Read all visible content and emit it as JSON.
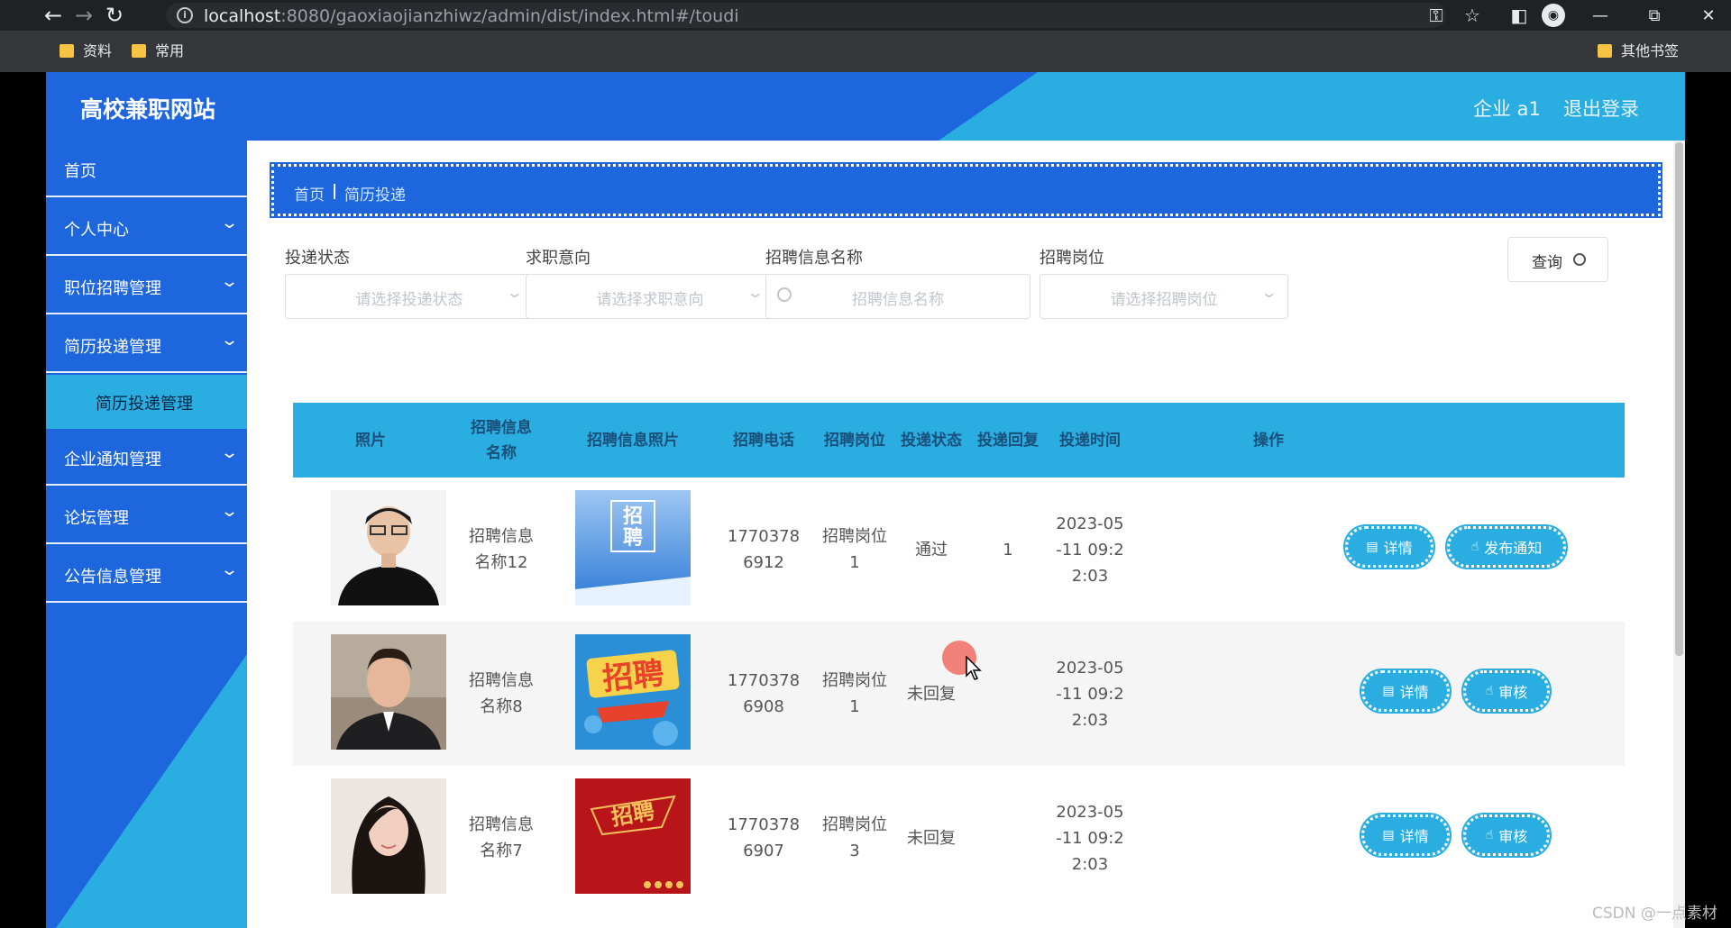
{
  "browser": {
    "url_host": "localhost",
    "url_rest": ":8080/gaoxiaojianzhiwz/admin/dist/index.html#/toudi",
    "bookmarks": [
      "资料",
      "常用"
    ],
    "other_bookmarks": "其他书签"
  },
  "header": {
    "brand": "高校兼职网站",
    "user": "企业 a1",
    "logout": "退出登录"
  },
  "sidebar": {
    "items": [
      {
        "label": "首页"
      },
      {
        "label": "个人中心"
      },
      {
        "label": "职位招聘管理"
      },
      {
        "label": "简历投递管理"
      },
      {
        "label": "企业通知管理"
      },
      {
        "label": "论坛管理"
      },
      {
        "label": "公告信息管理"
      }
    ],
    "sub_active": "简历投递管理"
  },
  "breadcrumb": {
    "home": "首页",
    "sep": "|",
    "current": "简历投递"
  },
  "filters": {
    "status_label": "投递状态",
    "status_placeholder": "请选择投递状态",
    "intent_label": "求职意向",
    "intent_placeholder": "请选择求职意向",
    "name_label": "招聘信息名称",
    "name_placeholder": "招聘信息名称",
    "post_label": "招聘岗位",
    "post_placeholder": "请选择招聘岗位",
    "query_button": "查询"
  },
  "table": {
    "headers": [
      "照片",
      "招聘信息\n名称",
      "招聘信息照片",
      "招聘电话",
      "招聘岗位",
      "投递状态",
      "投递回复",
      "投递时间",
      "操作"
    ],
    "rows": [
      {
        "name": "招聘信息\n名称12",
        "phone": "1770378\n6912",
        "post": "招聘岗位\n1",
        "status": "通过",
        "reply": "1",
        "time": "2023-05\n-11 09:2\n2:03",
        "btn1": "详情",
        "btn2": "发布通知"
      },
      {
        "name": "招聘信息\n名称8",
        "phone": "1770378\n6908",
        "post": "招聘岗位\n1",
        "status": "未回复",
        "reply": "",
        "time": "2023-05\n-11 09:2\n2:03",
        "btn1": "详情",
        "btn2": "审核"
      },
      {
        "name": "招聘信息\n名称7",
        "phone": "1770378\n6907",
        "post": "招聘岗位\n3",
        "status": "未回复",
        "reply": "",
        "time": "2023-05\n-11 09:2\n2:03",
        "btn1": "详情",
        "btn2": "审核"
      }
    ]
  },
  "poster_texts": [
    "招\n聘",
    "招聘",
    "招聘"
  ],
  "watermark": "CSDN @一点素材",
  "colors": {
    "primary_blue": "#1e66dd",
    "accent_cyan": "#2aaee2"
  }
}
